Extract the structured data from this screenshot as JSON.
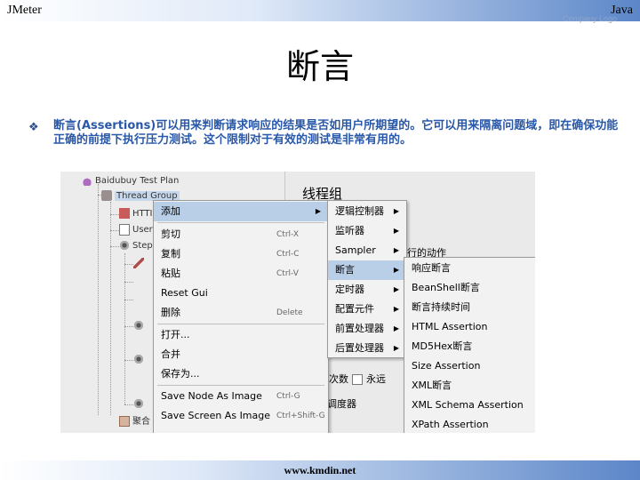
{
  "header": {
    "left": "JMeter",
    "right": "Java",
    "company": "Company Logo"
  },
  "title": "断言",
  "body_text": "断言(Assertions)可以用来判断请求响应的结果是否如用户所期望的。它可以用来隔离问题域，即在确保功能正确的前提下执行压力测试。这个限制对于有效的测试是非常有用的。",
  "footer": "www.kmdin.net",
  "screenshot": {
    "tree": [
      "Baidubuy Test Plan",
      "Thread Group",
      "HTTI",
      "User",
      "Step",
      "聚合"
    ],
    "panel_title": "线程组",
    "partial_texts": {
      "row_action": "行的动作",
      "loop_count": "次数",
      "forever": "永远",
      "scheduler": "调度器"
    },
    "context_menu": [
      {
        "label": "添加",
        "accel": ""
      },
      {
        "label": "剪切",
        "accel": "Ctrl-X"
      },
      {
        "label": "复制",
        "accel": "Ctrl-C"
      },
      {
        "label": "粘贴",
        "accel": "Ctrl-V"
      },
      {
        "label": "Reset Gui",
        "accel": ""
      },
      {
        "label": "删除",
        "accel": "Delete"
      },
      {
        "label": "打开...",
        "accel": ""
      },
      {
        "label": "合并",
        "accel": ""
      },
      {
        "label": "保存为...",
        "accel": ""
      },
      {
        "label": "Save Node As Image",
        "accel": "Ctrl-G"
      },
      {
        "label": "Save Screen As Image",
        "accel": "Ctrl+Shift-G"
      }
    ],
    "add_submenu": [
      "逻辑控制器",
      "监听器",
      "Sampler",
      "断言",
      "定时器",
      "配置元件",
      "前置处理器",
      "后置处理器"
    ],
    "assertion_submenu": [
      "响应断言",
      "BeanShell断言",
      "断言持续时间",
      "HTML Assertion",
      "MD5Hex断言",
      "Size Assertion",
      "XML断言",
      "XML Schema Assertion",
      "XPath Assertion"
    ]
  }
}
